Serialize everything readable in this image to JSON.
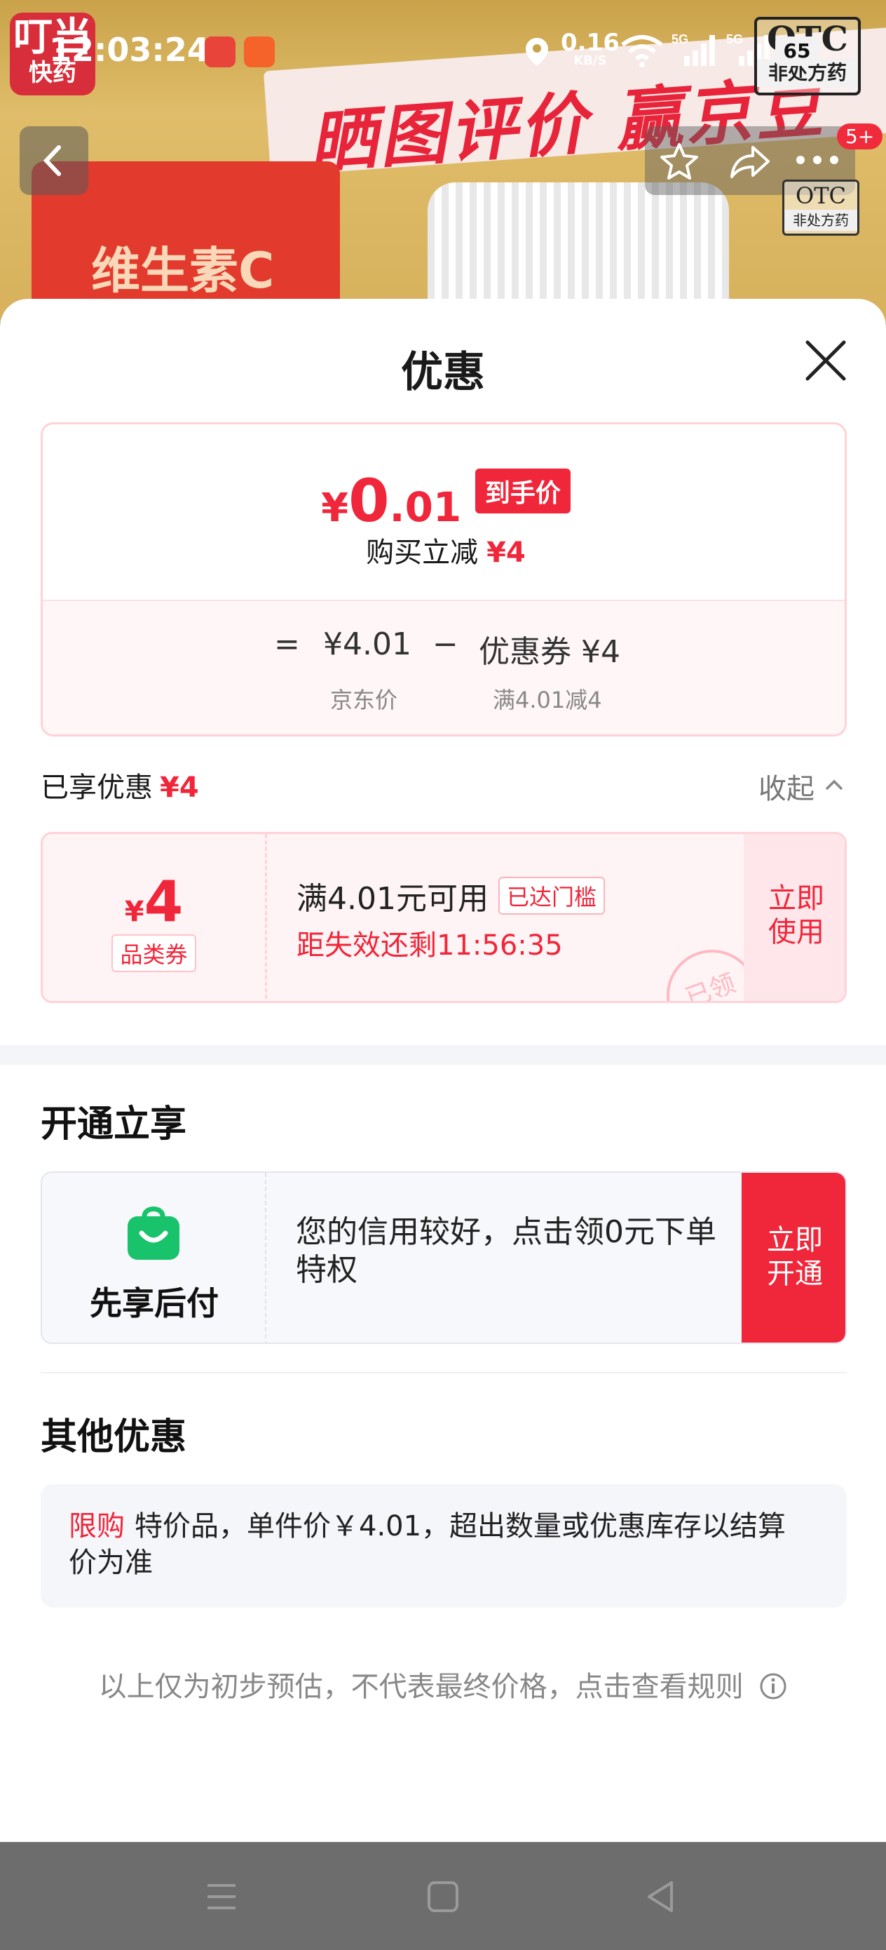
{
  "status_bar": {
    "app_logo_line1": "叮当",
    "app_logo_line2": "快药",
    "time": "12:03:24",
    "net_speed_value": "0.16",
    "net_speed_unit": "KB/S",
    "battery": "65",
    "otc_big": "OTC",
    "otc_small": "非处方药"
  },
  "background": {
    "banner_text": "晒图评价 赢京豆",
    "product_label": "维生素C"
  },
  "nav": {
    "badge": "5+",
    "otc_big": "OTC",
    "otc_small": "非处方药"
  },
  "sheet": {
    "title": "优惠",
    "price_card": {
      "currency": "¥",
      "price_int": "0",
      "price_dec": ".01",
      "hand_price_tag": "到手价",
      "instant_reduce_label": "购买立减",
      "instant_reduce_amount": "¥4",
      "formula_eq": "=",
      "formula_price": "¥4.01",
      "formula_minus": "−",
      "formula_coupon": "优惠券 ¥4",
      "formula_price_sub": "京东价",
      "formula_coupon_sub": "满4.01减4"
    },
    "enjoyed": {
      "label": "已享优惠",
      "amount": "¥4",
      "collapse_label": "收起"
    },
    "coupon": {
      "currency": "¥",
      "amount": "4",
      "type": "品类券",
      "condition": "满4.01元可用",
      "threshold_tag": "已达门槛",
      "timer": "距失效还剩11:56:35",
      "use_line1": "立即",
      "use_line2": "使用",
      "stamp": "已领"
    },
    "activate_section": {
      "title": "开通立享",
      "bnpl_label": "先享后付",
      "bnpl_desc": "您的信用较好，点击领0元下单特权",
      "btn_line1": "立即",
      "btn_line2": "开通"
    },
    "other_section": {
      "title": "其他优惠",
      "tag": "限购",
      "text": "特价品，单件价￥4.01，超出数量或优惠库存以结算价为准"
    },
    "footnote": "以上仅为初步预估，不代表最终价格，点击查看规则"
  },
  "colors": {
    "accent_red": "#f0263a",
    "bnpl_green": "#19c36b"
  },
  "icons": [
    "location-icon",
    "wifi-icon",
    "signal-icon",
    "back-arrow-icon",
    "star-icon",
    "share-icon",
    "more-icon",
    "close-icon",
    "chevron-up-icon",
    "shopping-bag-icon",
    "info-icon",
    "menu-icon",
    "home-icon",
    "back-triangle-icon"
  ]
}
